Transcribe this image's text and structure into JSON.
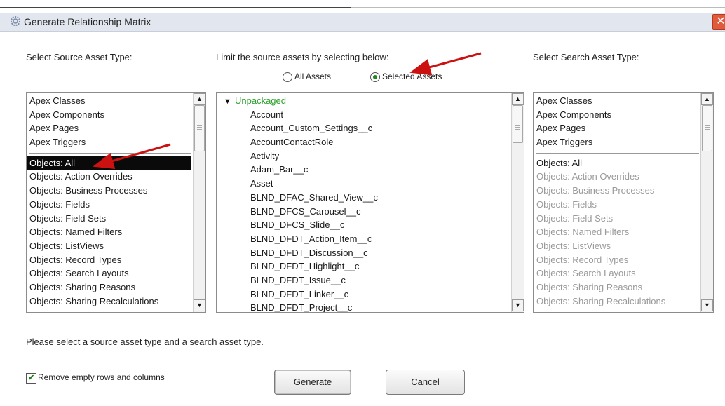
{
  "window": {
    "title": "Generate Relationship Matrix",
    "icons": {
      "title": "gear-icon",
      "close": "close-icon"
    }
  },
  "labels": {
    "source_type": "Select Source Asset Type:",
    "limit": "Limit the source assets by selecting below:",
    "search_type": "Select Search Asset Type:"
  },
  "radio": {
    "all_assets": "All Assets",
    "selected_assets": "Selected Assets",
    "selected": "selected_assets"
  },
  "source_list": {
    "items": [
      {
        "label": "Apex Classes"
      },
      {
        "label": "Apex Components"
      },
      {
        "label": "Apex Pages"
      },
      {
        "label": "Apex Triggers"
      },
      {
        "sep": true
      },
      {
        "label": "Objects: All",
        "selected": true
      },
      {
        "label": "Objects: Action Overrides"
      },
      {
        "label": "Objects: Business Processes"
      },
      {
        "label": "Objects: Fields"
      },
      {
        "label": "Objects: Field Sets"
      },
      {
        "label": "Objects: Named Filters"
      },
      {
        "label": "Objects: ListViews"
      },
      {
        "label": "Objects: Record Types"
      },
      {
        "label": "Objects: Search Layouts"
      },
      {
        "label": "Objects: Sharing Reasons"
      },
      {
        "label": "Objects: Sharing Recalculations"
      }
    ]
  },
  "assets_tree": {
    "root": "Unpackaged",
    "items": [
      "Account",
      "Account_Custom_Settings__c",
      "AccountContactRole",
      "Activity",
      "Adam_Bar__c",
      "Asset",
      "BLND_DFAC_Shared_View__c",
      "BLND_DFCS_Carousel__c",
      "BLND_DFCS_Slide__c",
      "BLND_DFDT_Action_Item__c",
      "BLND_DFDT_Discussion__c",
      "BLND_DFDT_Highlight__c",
      "BLND_DFDT_Issue__c",
      "BLND_DFDT_Linker__c",
      "BLND_DFDT_Project__c"
    ]
  },
  "search_list": {
    "items": [
      {
        "label": "Apex Classes"
      },
      {
        "label": "Apex Components"
      },
      {
        "label": "Apex Pages"
      },
      {
        "label": "Apex Triggers"
      },
      {
        "sep": true
      },
      {
        "label": "Objects: All"
      },
      {
        "label": "Objects: Action Overrides",
        "disabled": true
      },
      {
        "label": "Objects: Business Processes",
        "disabled": true
      },
      {
        "label": "Objects: Fields",
        "disabled": true
      },
      {
        "label": "Objects: Field Sets",
        "disabled": true
      },
      {
        "label": "Objects: Named Filters",
        "disabled": true
      },
      {
        "label": "Objects: ListViews",
        "disabled": true
      },
      {
        "label": "Objects: Record Types",
        "disabled": true
      },
      {
        "label": "Objects: Search Layouts",
        "disabled": true
      },
      {
        "label": "Objects: Sharing Reasons",
        "disabled": true
      },
      {
        "label": "Objects: Sharing Recalculations",
        "disabled": true
      }
    ]
  },
  "status_message": "Please select a source asset type and a search asset type.",
  "options": {
    "remove_empty_label": "Remove empty rows and columns",
    "remove_empty_checked": true
  },
  "buttons": {
    "generate": "Generate",
    "cancel": "Cancel"
  },
  "annotation_color": "#cc1111"
}
